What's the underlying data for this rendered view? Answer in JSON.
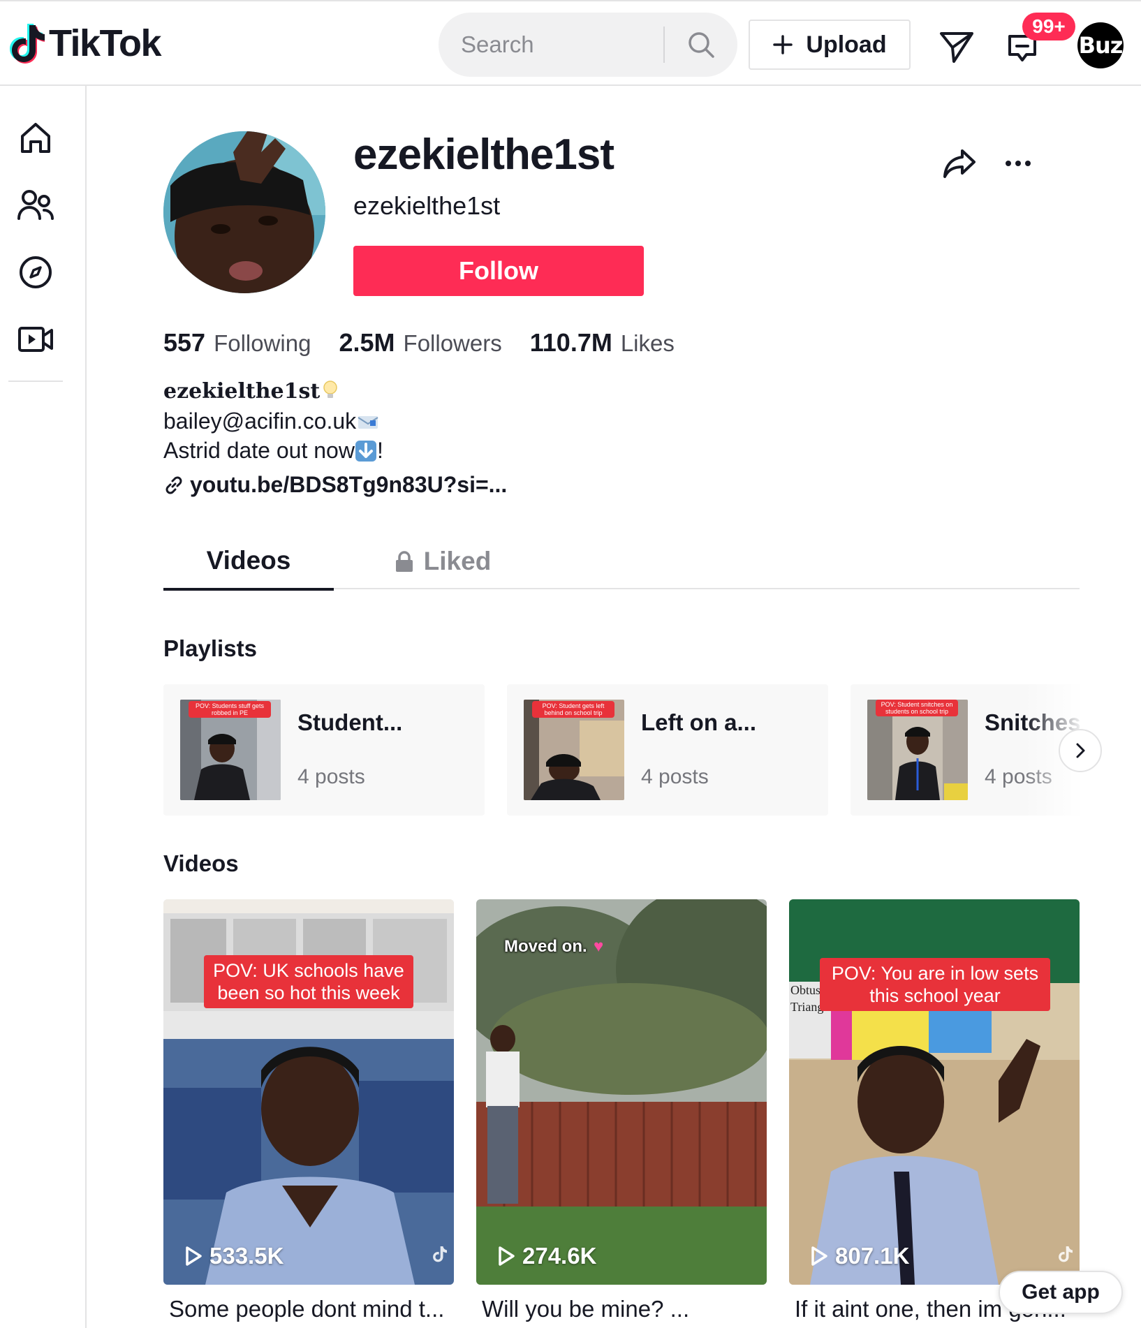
{
  "header": {
    "logo_text": "TikTok",
    "search_placeholder": "Search",
    "upload_label": "Upload",
    "notification_badge": "99+",
    "user_avatar_text": "Buz"
  },
  "sidebar": {
    "items": [
      {
        "icon": "home-icon"
      },
      {
        "icon": "following-icon"
      },
      {
        "icon": "explore-icon"
      },
      {
        "icon": "live-icon"
      }
    ]
  },
  "profile": {
    "title": "ezekielthe1st",
    "username": "ezekielthe1st",
    "follow_label": "Follow",
    "stats": [
      {
        "value": "557",
        "label": "Following"
      },
      {
        "value": "2.5M",
        "label": "Followers"
      },
      {
        "value": "110.7M",
        "label": "Likes"
      }
    ],
    "bio_line1": "ezekielthe1st",
    "bio_line2": "bailey@acifin.co.uk",
    "bio_line3": "Astrid date out now",
    "bio_line3_suffix": "!",
    "link": "youtu.be/BDS8Tg9n83U?si=..."
  },
  "tabs": {
    "videos": "Videos",
    "liked": "Liked"
  },
  "playlists": {
    "title": "Playlists",
    "items": [
      {
        "name": "Student...",
        "count": "4 posts",
        "thumb_text": "POV: Students stuff gets robbed in PE"
      },
      {
        "name": "Left on a...",
        "count": "4 posts",
        "thumb_text": "POV: Student gets left behind on school trip"
      },
      {
        "name": "Snitches",
        "count": "4 posts",
        "thumb_text": "POV: Student snitches on students on school trip"
      }
    ]
  },
  "videos": {
    "title": "Videos",
    "items": [
      {
        "views": "533.5K",
        "caption": "Some people dont mind t...",
        "overlay": "POV: UK schools have been so hot this week"
      },
      {
        "views": "274.6K",
        "caption": "Will you be mine? ...",
        "overlay": "Moved on."
      },
      {
        "views": "807.1K",
        "caption": "If it aint one, then im gon...",
        "overlay": "POV: You are in low sets this school year",
        "board_text_1": "Obtuse",
        "board_text_2": "Triangle"
      }
    ]
  },
  "get_app_label": "Get app",
  "colors": {
    "brand": "#fe2c55",
    "text": "#161823",
    "muted": "#8a8b91"
  }
}
